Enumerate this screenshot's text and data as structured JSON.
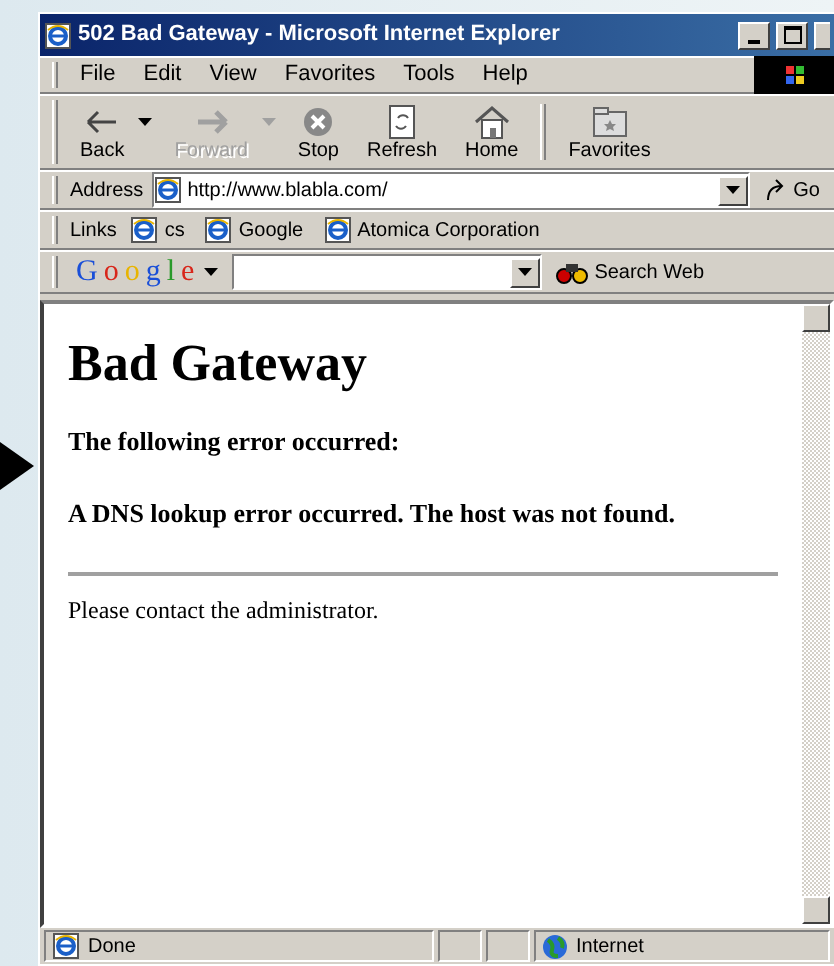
{
  "window": {
    "title": "502 Bad Gateway - Microsoft Internet Explorer"
  },
  "menu": [
    {
      "label": "File"
    },
    {
      "label": "Edit"
    },
    {
      "label": "View"
    },
    {
      "label": "Favorites"
    },
    {
      "label": "Tools"
    },
    {
      "label": "Help"
    }
  ],
  "toolbar": [
    {
      "label": "Back",
      "kind": "back",
      "disabled": false,
      "dropdown": true
    },
    {
      "label": "Forward",
      "kind": "forward",
      "disabled": true,
      "dropdown": true
    },
    {
      "label": "Stop",
      "kind": "stop",
      "disabled": false,
      "dropdown": false
    },
    {
      "label": "Refresh",
      "kind": "refresh",
      "disabled": false,
      "dropdown": false
    },
    {
      "label": "Home",
      "kind": "home",
      "disabled": false,
      "dropdown": false
    },
    {
      "label": "Favorites",
      "kind": "favorites",
      "disabled": false,
      "dropdown": false
    }
  ],
  "address_bar": {
    "label": "Address",
    "value": "http://www.blabla.com/",
    "go": "Go"
  },
  "links_bar": {
    "label": "Links",
    "links": [
      {
        "label": "cs"
      },
      {
        "label": "Google"
      },
      {
        "label": "Atomica Corporation"
      }
    ]
  },
  "google_bar": {
    "logo": "Google",
    "search_button": "Search Web"
  },
  "page": {
    "heading": "Bad Gateway",
    "lines": [
      "The following error occurred:",
      "A DNS lookup error occurred. The host was not found."
    ],
    "footer": "Please contact the administrator."
  },
  "status_bar": {
    "text": "Done",
    "zone": "Internet"
  }
}
